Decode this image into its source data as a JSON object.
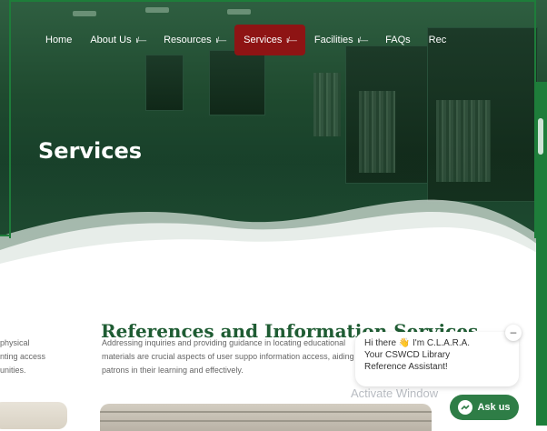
{
  "nav": {
    "items": [
      {
        "label": "Home",
        "has_caret": false,
        "active": false
      },
      {
        "label": "About Us",
        "has_caret": true,
        "active": false
      },
      {
        "label": "Resources",
        "has_caret": true,
        "active": false
      },
      {
        "label": "Services",
        "has_caret": true,
        "active": true
      },
      {
        "label": "Facilities",
        "has_caret": true,
        "active": false
      },
      {
        "label": "FAQs",
        "has_caret": false,
        "active": false
      },
      {
        "label": "Rec",
        "has_caret": false,
        "active": false
      }
    ],
    "caret_glyph": "ɩ/—",
    "active_color": "#8e1414"
  },
  "hero": {
    "title": "Services"
  },
  "section": {
    "title": "References and Information Services",
    "body": "Addressing inquiries and providing guidance in locating educational materials are crucial aspects of user suppo information access, aiding patrons in their learning and effectively.",
    "left_snippet": "physical\nnting access\nunities."
  },
  "chat": {
    "greeting_line1": "Hi there",
    "greeting_emoji": "👋",
    "greeting_line1b": "I'm C.L.A.R.A.",
    "greeting_line2": "Your CSWCD Library",
    "greeting_line3": "Reference Assistant!",
    "ask_label": "Ask us",
    "close_glyph": "–"
  },
  "overlay": {
    "activate_text": "Activate Window"
  },
  "colors": {
    "brand_green": "#1f5c33",
    "accent_green": "#2e7d46",
    "nav_active": "#8e1414"
  }
}
